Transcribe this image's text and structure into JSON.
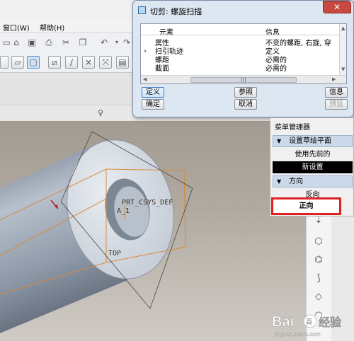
{
  "menubar": {
    "window": "窗口(W)",
    "help": "帮助(H)"
  },
  "dialog": {
    "title": "切剪: 螺旋扫描",
    "close_glyph": "✕",
    "columns": {
      "element": "元素",
      "info": "信息"
    },
    "rows": [
      {
        "element": "属性",
        "info": "不变的螺距, 右旋, 穿"
      },
      {
        "element": "扫引轨迹",
        "info": "定义"
      },
      {
        "element": "螺距",
        "info": "必需的"
      },
      {
        "element": "截面",
        "info": "必需的"
      }
    ],
    "buttons": {
      "define": "定义",
      "reference": "参照",
      "info": "信息",
      "ok": "确定",
      "cancel": "取消",
      "preview": "预览"
    }
  },
  "menu_manager": {
    "title": "菜单管理器",
    "section1": "设置草绘平面",
    "use_previous": "使用先前的",
    "new_setup": "新设置",
    "section2": "方向",
    "reverse": "反向",
    "forward": "正向"
  },
  "viewport": {
    "csys_label": "PRT_CSYS_DEF",
    "axis_label": "A_1",
    "datum_label": "TOP"
  },
  "watermark": {
    "brand": "Bai",
    "paw": "百",
    "suffix": "经验",
    "url": "jingyan.baidu.com"
  },
  "colors": {
    "highlight": "#e12222",
    "selected": "#000000",
    "dialog_bg": "#dde7f1"
  },
  "icons": [
    "arrow-icon",
    "folder-icon",
    "save-icon",
    "print-icon",
    "undo-icon",
    "sketch-icon",
    "view-icon"
  ]
}
